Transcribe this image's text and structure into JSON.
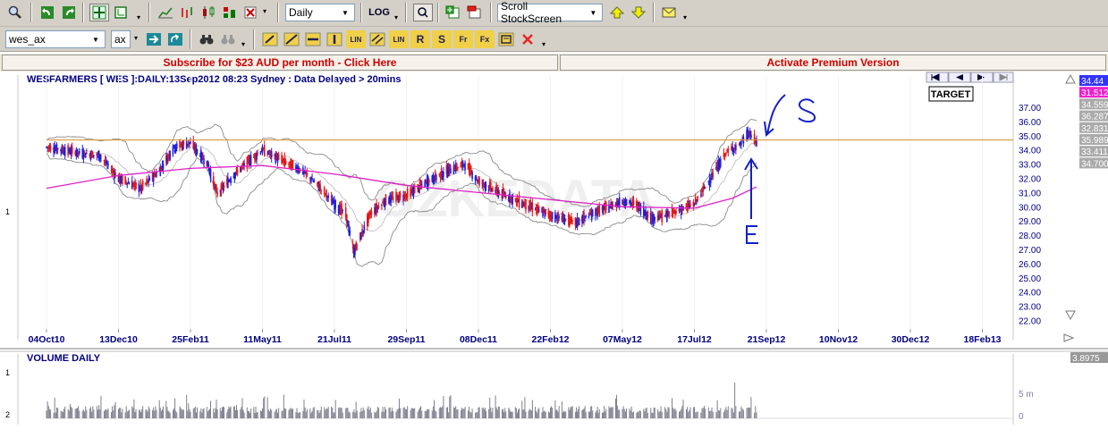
{
  "toolbar1": {
    "period_select": "Daily",
    "log_label": "LOG",
    "scroll_select": "Scroll StockScreen"
  },
  "toolbar2": {
    "symbol_input": "wes_ax",
    "exchange_select": "ax",
    "tool_labels": [
      "LIN",
      "LIN",
      "R",
      "S",
      "Fr",
      "Fx"
    ]
  },
  "banner": {
    "subscribe": "Subscribe for $23 AUD per month - Click Here",
    "activate": "Activate Premium Version"
  },
  "chart_header": {
    "title": "WESFARMERS [ WES ]:DAILY:13Sep2012 08:23 Sydney : Data Delayed > 20mins",
    "target_label": "TARGET",
    "watermark": "OZKEDATA"
  },
  "side_labels": {
    "price_values": [
      "34.44",
      "31.512",
      "34.559",
      "36.287",
      "32.831",
      "35.989",
      "33.411",
      "34.700"
    ],
    "volume_value": "3.8975",
    "price_pane_number": "1",
    "volume_pane_numbers": [
      "1",
      "2"
    ]
  },
  "annotations": {
    "S": "S",
    "E": "E"
  },
  "chart_data": [
    {
      "type": "candlestick",
      "title": "WESFARMERS [ WES ]:DAILY:13Sep2012 08:23 Sydney : Data Delayed > 20mins",
      "x_tick_labels": [
        "04Oct10",
        "13Dec10",
        "25Feb11",
        "11May11",
        "21Jul11",
        "29Sep11",
        "08Dec11",
        "22Feb12",
        "07May12",
        "17Jul12",
        "21Sep12",
        "10Nov12",
        "30Dec12",
        "18Feb13"
      ],
      "y_tick_labels": [
        "37.00",
        "36.00",
        "35.00",
        "34.00",
        "33.00",
        "32.00",
        "31.00",
        "30.00",
        "29.00",
        "28.00",
        "27.00",
        "26.00",
        "25.00",
        "24.00",
        "23.00",
        "22.00"
      ],
      "ylim": [
        21.4,
        38.0
      ],
      "horizontal_line": 34.7,
      "price_path": [
        {
          "x": "04Oct10",
          "y": 34.2
        },
        {
          "x": "04Nov10",
          "y": 33.8
        },
        {
          "x": "25Nov10",
          "y": 33.6
        },
        {
          "x": "13Dec10",
          "y": 32.0
        },
        {
          "x": "05Jan11",
          "y": 31.3
        },
        {
          "x": "25Jan11",
          "y": 32.6
        },
        {
          "x": "08Feb11",
          "y": 34.2
        },
        {
          "x": "25Feb11",
          "y": 34.5
        },
        {
          "x": "15Mar11",
          "y": 33.0
        },
        {
          "x": "25Mar11",
          "y": 30.9
        },
        {
          "x": "15Apr11",
          "y": 32.5
        },
        {
          "x": "11May11",
          "y": 34.0
        },
        {
          "x": "01Jun11",
          "y": 33.2
        },
        {
          "x": "20Jun11",
          "y": 32.5
        },
        {
          "x": "05Jul11",
          "y": 31.5
        },
        {
          "x": "21Jul11",
          "y": 30.2
        },
        {
          "x": "01Aug11",
          "y": 29.5
        },
        {
          "x": "09Aug11",
          "y": 26.8
        },
        {
          "x": "25Aug11",
          "y": 29.5
        },
        {
          "x": "10Sep11",
          "y": 30.5
        },
        {
          "x": "29Sep11",
          "y": 30.8
        },
        {
          "x": "20Oct11",
          "y": 31.8
        },
        {
          "x": "10Nov11",
          "y": 32.6
        },
        {
          "x": "25Nov11",
          "y": 33.0
        },
        {
          "x": "08Dec11",
          "y": 31.8
        },
        {
          "x": "30Dec11",
          "y": 31.0
        },
        {
          "x": "25Jan12",
          "y": 30.2
        },
        {
          "x": "22Feb12",
          "y": 29.4
        },
        {
          "x": "20Mar12",
          "y": 28.9
        },
        {
          "x": "05Apr12",
          "y": 29.5
        },
        {
          "x": "07May12",
          "y": 30.4
        },
        {
          "x": "20May12",
          "y": 30.2
        },
        {
          "x": "05Jun12",
          "y": 29.2
        },
        {
          "x": "20Jun12",
          "y": 29.4
        },
        {
          "x": "17Jul12",
          "y": 30.2
        },
        {
          "x": "01Aug12",
          "y": 32.0
        },
        {
          "x": "15Aug12",
          "y": 33.8
        },
        {
          "x": "28Aug12",
          "y": 34.4
        },
        {
          "x": "05Sep12",
          "y": 35.2
        },
        {
          "x": "12Sep12",
          "y": 34.5
        }
      ],
      "moving_average": [
        {
          "x": "04Oct10",
          "y": 31.3
        },
        {
          "x": "13Dec10",
          "y": 32.2
        },
        {
          "x": "25Feb11",
          "y": 32.7
        },
        {
          "x": "11May11",
          "y": 32.9
        },
        {
          "x": "21Jul11",
          "y": 32.3
        },
        {
          "x": "29Sep11",
          "y": 31.5
        },
        {
          "x": "08Dec11",
          "y": 31.0
        },
        {
          "x": "22Feb12",
          "y": 30.5
        },
        {
          "x": "07May12",
          "y": 30.0
        },
        {
          "x": "17Jul12",
          "y": 29.9
        },
        {
          "x": "21Aug12",
          "y": 30.6
        },
        {
          "x": "12Sep12",
          "y": 31.4
        }
      ]
    },
    {
      "type": "bar",
      "title": "VOLUME DAILY",
      "y_tick_labels": [
        "5 m",
        "0"
      ]
    }
  ]
}
